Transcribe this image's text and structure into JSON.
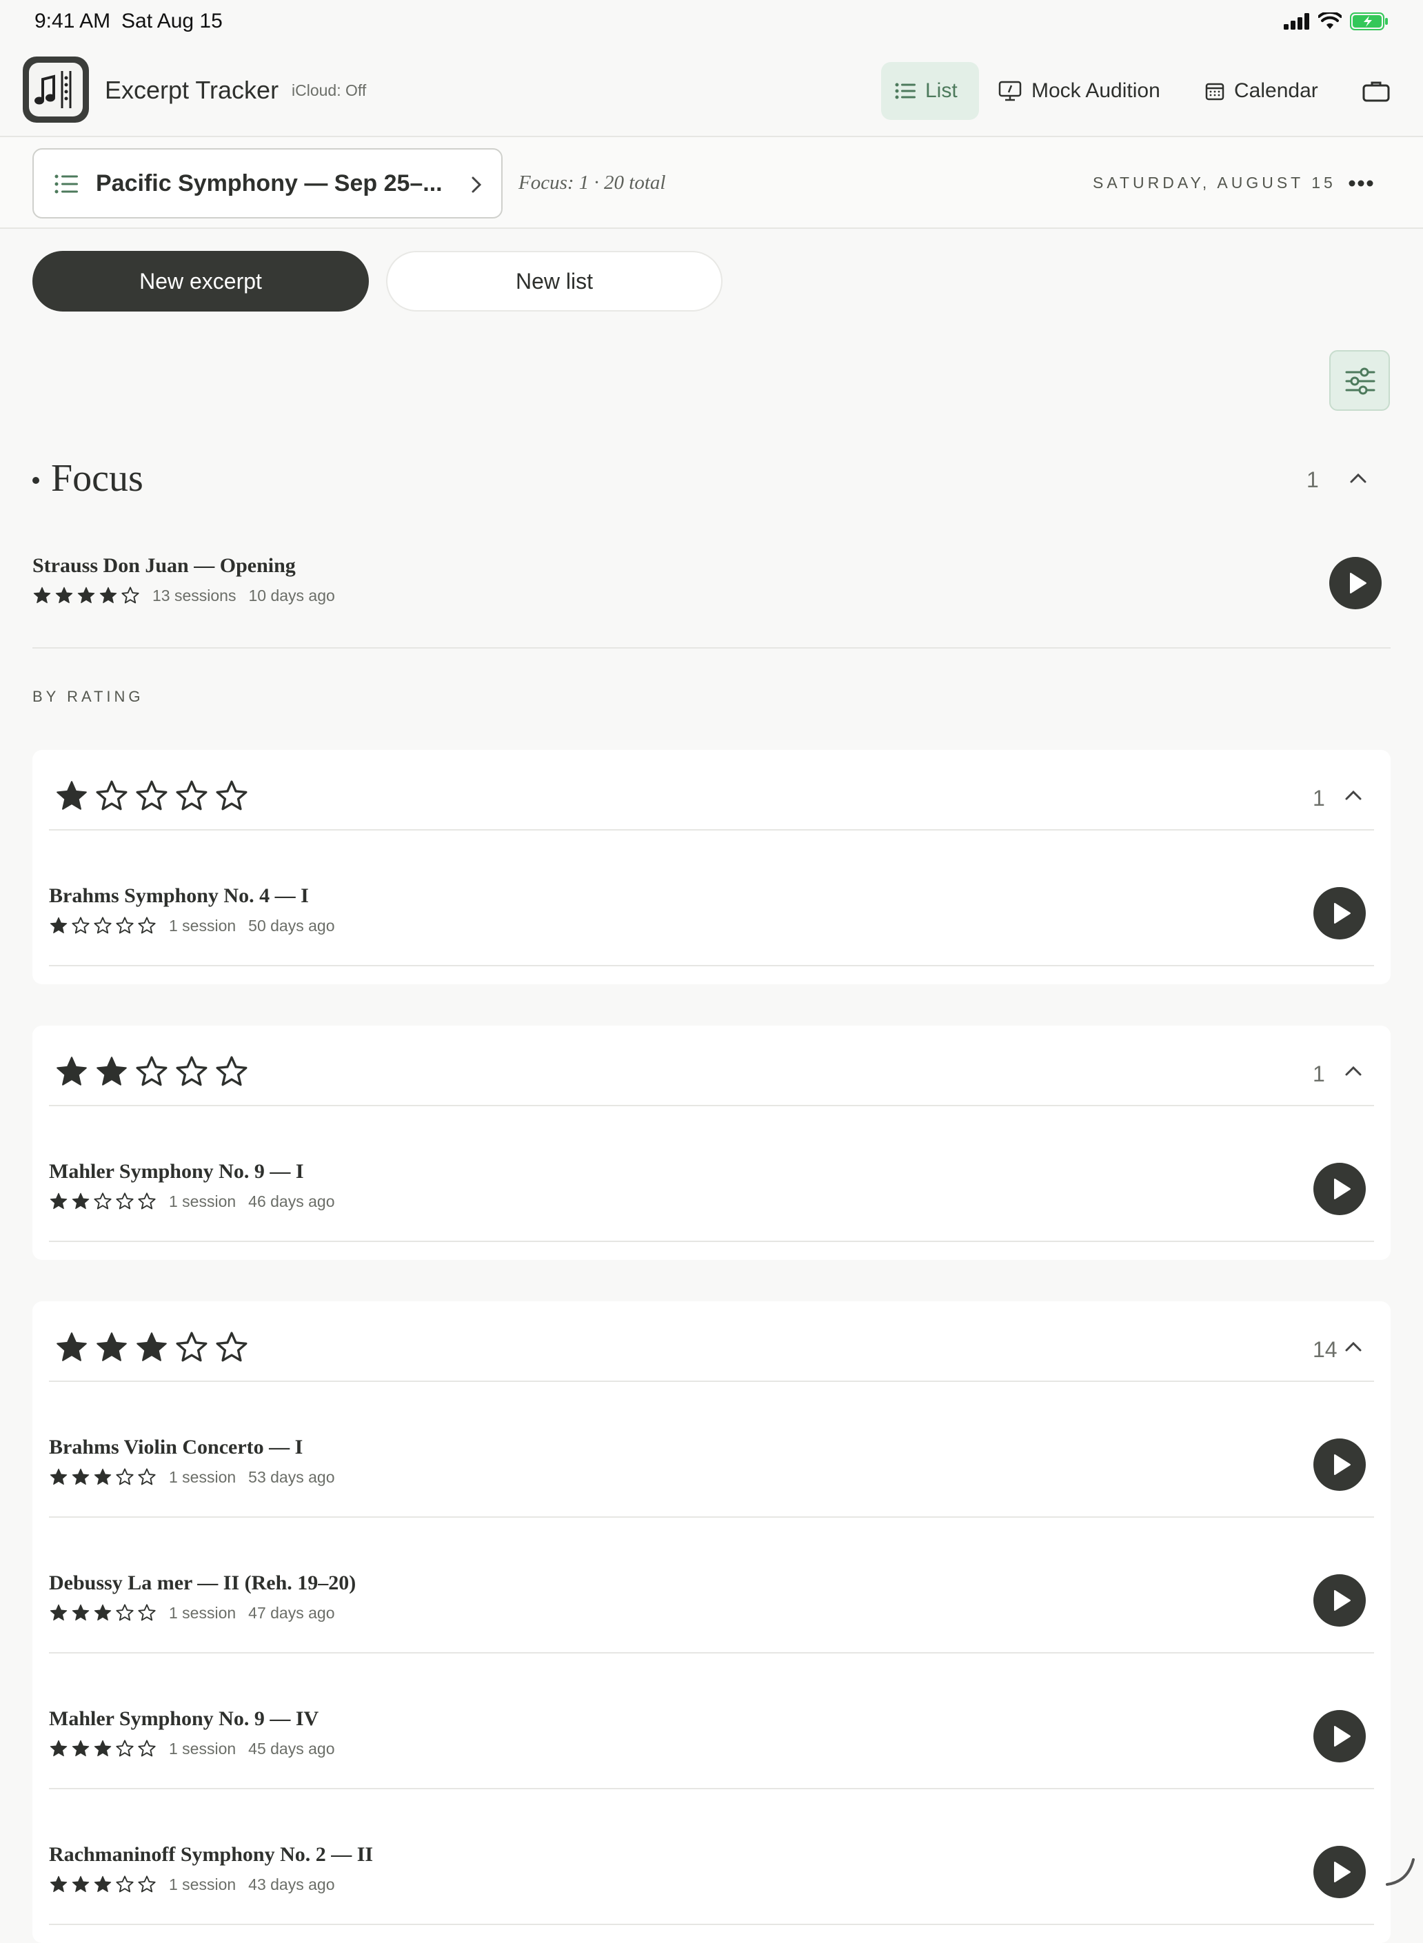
{
  "status": {
    "time": "9:41 AM",
    "date": "Sat Aug 15"
  },
  "app": {
    "title": "Excerpt Tracker",
    "icloud": "iCloud: Off",
    "nav": {
      "list": "List",
      "mock": "Mock Audition",
      "calendar": "Calendar"
    }
  },
  "subheader": {
    "list_name": "Pacific Symphony — Sep 25–...",
    "focus_summary": "Focus: 1 · 20 total",
    "day_label": "SATURDAY, AUGUST 15"
  },
  "actions": {
    "new_excerpt": "New excerpt",
    "new_list": "New list"
  },
  "focus": {
    "heading": "Focus",
    "count": "1",
    "items": [
      {
        "title": "Strauss Don Juan — Opening",
        "rating": 4,
        "sessions": "13 sessions",
        "ago": "10 days ago"
      }
    ]
  },
  "by_rating_label": "BY RATING",
  "groups": [
    {
      "rating": 1,
      "count": "1",
      "items": [
        {
          "title": "Brahms Symphony No. 4 — I",
          "rating": 1,
          "sessions": "1 session",
          "ago": "50 days ago"
        }
      ]
    },
    {
      "rating": 2,
      "count": "1",
      "items": [
        {
          "title": "Mahler Symphony No. 9 — I",
          "rating": 2,
          "sessions": "1 session",
          "ago": "46 days ago"
        }
      ]
    },
    {
      "rating": 3,
      "count": "14",
      "items": [
        {
          "title": "Brahms Violin Concerto — I",
          "rating": 3,
          "sessions": "1 session",
          "ago": "53 days ago"
        },
        {
          "title": "Debussy La mer — II (Reh. 19–20)",
          "rating": 3,
          "sessions": "1 session",
          "ago": "47 days ago"
        },
        {
          "title": "Mahler Symphony No. 9 — IV",
          "rating": 3,
          "sessions": "1 session",
          "ago": "45 days ago"
        },
        {
          "title": "Rachmaninoff Symphony No. 2 — II",
          "rating": 3,
          "sessions": "1 session",
          "ago": "43 days ago"
        }
      ]
    }
  ]
}
